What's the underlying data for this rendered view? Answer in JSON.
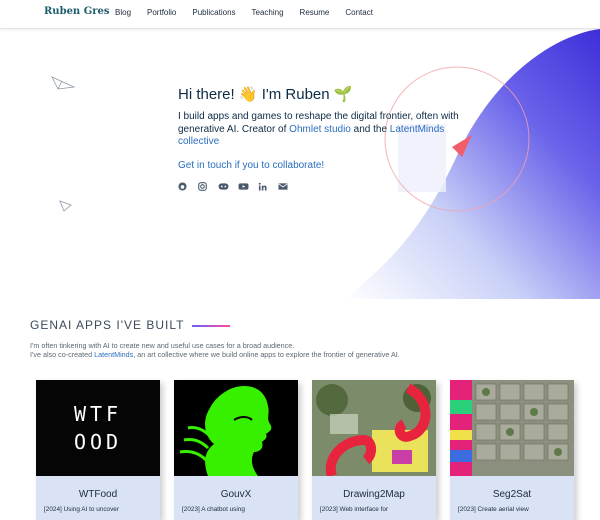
{
  "nav": {
    "brand": "Ruben Gres",
    "links": [
      "Blog",
      "Portfolio",
      "Publications",
      "Teaching",
      "Resume",
      "Contact"
    ]
  },
  "hero": {
    "greeting": "Hi there! 👋 I'm Ruben 🌱",
    "intro_prefix": "I build apps and games to reshape the digital frontier, often with generative AI. Creator of ",
    "studio_link": "Ohmlet studio",
    "intro_mid": " and the ",
    "collective_link": "LatentMinds collective",
    "cta": "Get in touch if you to collaborate!",
    "socials": [
      "github-icon",
      "instagram-icon",
      "discord-icon",
      "youtube-icon",
      "linkedin-icon",
      "email-icon"
    ],
    "accent": "#4b3fe0"
  },
  "apps": {
    "title": "GENAI APPS I'VE BUILT",
    "desc_line1": "I'm often tinkering with AI to create new and useful use cases for a broad audience.",
    "desc_prefix": "I've also co-created ",
    "desc_link": "LatentMinds",
    "desc_suffix": ", an art collective where we build online apps to explore the frontier of generative AI.",
    "cards": [
      {
        "title": "WTFood",
        "desc": "[2024] Using AI to uncover",
        "thumb_line1": "WTF",
        "thumb_line2": "OOD"
      },
      {
        "title": "GouvX",
        "desc": "[2023] A chatbot using"
      },
      {
        "title": "Drawing2Map",
        "desc": "[2023] Web interface for"
      },
      {
        "title": "Seg2Sat",
        "desc": "[2023] Create aerial view"
      }
    ]
  }
}
